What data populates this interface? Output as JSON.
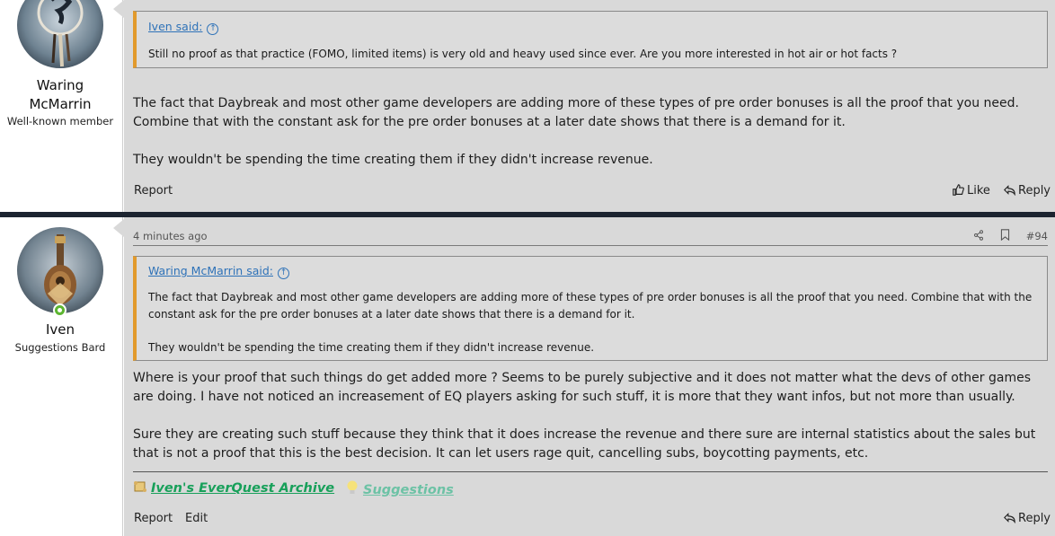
{
  "post1": {
    "author": {
      "name": "Waring McMarrin",
      "name_line1": "Waring",
      "name_line2": "McMarrin",
      "title": "Well-known member"
    },
    "quote": {
      "attribution": "Iven said:",
      "text": "Still no proof as that practice (FOMO, limited items) is very old and heavy used since ever. Are you more interested in hot air or hot facts ?"
    },
    "body": [
      "The fact that Daybreak and most other game developers are adding more of these types of pre order bonuses is all the proof that you need. Combine that with the constant ask for the pre order bonuses at a later date shows that there is a demand for it.",
      "They wouldn't be spending the time creating them if they didn't increase revenue."
    ],
    "actions": {
      "report": "Report",
      "like": "Like",
      "reply": "Reply"
    }
  },
  "post2": {
    "author": {
      "name": "Iven",
      "title": "Suggestions Bard",
      "online": true
    },
    "timestamp": "4 minutes ago",
    "post_number": "#94",
    "quote": {
      "attribution": "Waring McMarrin said:",
      "text1": "The fact that Daybreak and most other game developers are adding more of these types of pre order bonuses is all the proof that you need. Combine that with the constant ask for the pre order bonuses at a later date shows that there is a demand for it.",
      "text2": "They wouldn't be spending the time creating them if they didn't increase revenue."
    },
    "body": [
      "Where is your proof that such things do get added more ? Seems to be purely subjective and it does not matter what the devs of other games are doing. I have not noticed an increasement of EQ players asking for such stuff, it is more that they want infos, but not more than usually.",
      "Sure they are creating such stuff because they think that it does increase the revenue and there sure are internal statistics about the sales but that is not a proof that this is the best decision. It can let users rage quit, cancelling subs, boycotting payments, etc."
    ],
    "signature": {
      "archive_link": "Iven's EverQuest Archive",
      "suggestions_link": "Suggestions"
    },
    "actions": {
      "report": "Report",
      "edit": "Edit",
      "reply": "Reply"
    }
  },
  "colors": {
    "quote_accent": "#e29a2c",
    "link": "#2e72b8",
    "online": "#5cb531",
    "sig_archive": "#18a05a",
    "sig_suggest": "#6cc2a5",
    "separator": "#1c2430"
  },
  "icons": [
    "share-icon",
    "bookmark-icon",
    "like-icon",
    "reply-icon",
    "scroll-icon",
    "lightbulb-icon",
    "arrow-up-circle-icon"
  ]
}
